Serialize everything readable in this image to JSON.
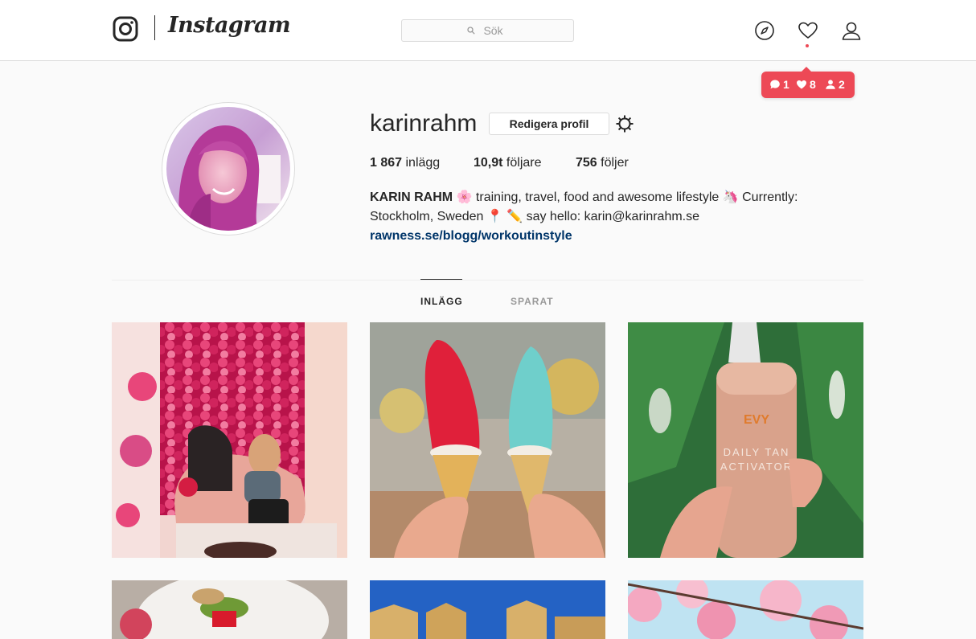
{
  "nav": {
    "brand": "Instagram",
    "search_placeholder": "Sök"
  },
  "notifications": {
    "comments": "1",
    "likes": "8",
    "followers": "2"
  },
  "profile": {
    "username": "karinrahm",
    "edit_label": "Redigera profil",
    "stats": {
      "posts_count": "1 867",
      "posts_label": "inlägg",
      "followers_count": "10,9t",
      "followers_label": "följare",
      "following_count": "756",
      "following_label": "följer"
    },
    "bio": {
      "name": "KARIN RAHM",
      "line1_rest": "🌸 training, travel, food and awesome lifestyle 🦄 Currently:",
      "line2": "Stockholm, Sweden 📍 ✏️ say hello: karin@karinrahm.se",
      "link": "rawness.se/blogg/workoutinstyle"
    }
  },
  "tabs": {
    "posts": "INLÄGG",
    "saved": "SPARAT"
  },
  "colors": {
    "accent": "#ed4956",
    "link": "#003569",
    "border": "#dbdbdb",
    "background": "#fafafa"
  },
  "posts_grid": [
    {
      "name": "post-flower-wall",
      "product_text_1": "",
      "product_text_2": ""
    },
    {
      "name": "post-ice-creams"
    },
    {
      "name": "post-evy-bottle",
      "brand": "EVY",
      "product_line1": "DAILY TAN",
      "product_line2": "ACTIVATOR"
    },
    {
      "name": "post-food-plate"
    },
    {
      "name": "post-building"
    },
    {
      "name": "post-cherry-blossom"
    }
  ]
}
